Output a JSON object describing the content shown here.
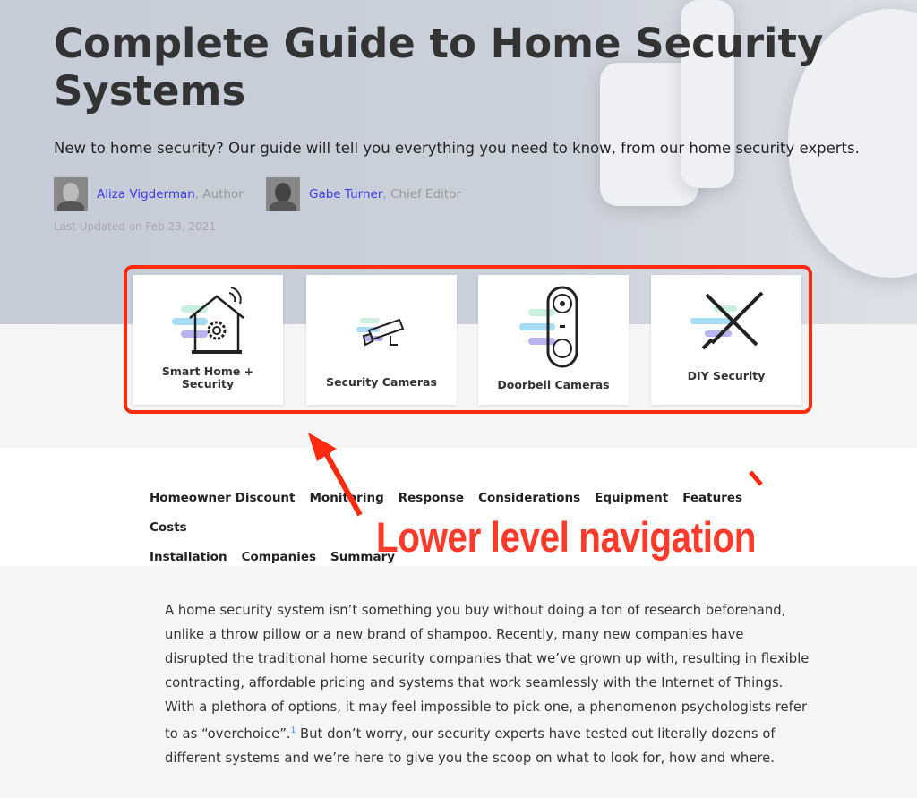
{
  "header": {
    "title": "Complete Guide to Home Security Systems",
    "subtitle": "New to home security? Our guide will tell you everything you need to know, from our home security experts.",
    "authors": [
      {
        "name": "Aliza Vigderman",
        "role": ", Author"
      },
      {
        "name": "Gabe Turner",
        "role": ", Chief Editor"
      }
    ],
    "last_updated": "Last Updated on Feb 23, 2021"
  },
  "categories": [
    {
      "label": "Smart Home + Security",
      "icon": "smart-home-icon"
    },
    {
      "label": "Security Cameras",
      "icon": "security-camera-icon"
    },
    {
      "label": "Doorbell Cameras",
      "icon": "doorbell-camera-icon"
    },
    {
      "label": "DIY Security",
      "icon": "tools-icon"
    }
  ],
  "subnav": [
    "Homeowner Discount",
    "Monitoring",
    "Response",
    "Considerations",
    "Equipment",
    "Features",
    "Costs",
    "Installation",
    "Companies",
    "Summary"
  ],
  "annotation": "Lower level navigation",
  "body": {
    "paragraph_before": "A home security system isn’t something you buy without doing a ton of research beforehand, unlike a throw pillow or a new brand of shampoo. Recently, many new companies have disrupted the traditional home security companies that we’ve grown up with, resulting in flexible contracting, affordable pricing and systems that work seamlessly with the Internet of Things. With a plethora of options, it may feel impossible to pick one, a phenomenon psychologists refer to as “overchoice”.",
    "footnote": "1",
    "paragraph_after": " But don’t worry, our security experts have tested out literally dozens of different systems and we’re here to give you the scoop on what to look for, how and where."
  },
  "colors": {
    "annotation": "#ff2a10",
    "link": "#3b3be0",
    "hero_bg": "#c9cfd9"
  }
}
